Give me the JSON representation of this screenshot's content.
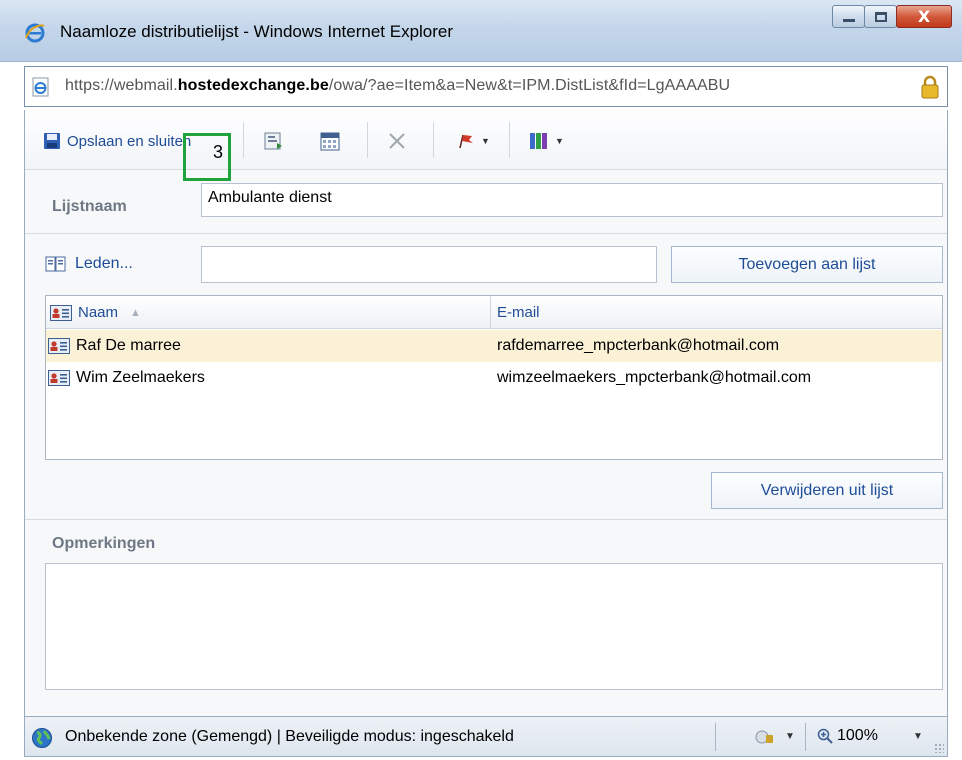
{
  "window": {
    "title": "Naamloze distributielijst - Windows Internet Explorer",
    "close_label": "X"
  },
  "address": {
    "prefix": "https://webmail.",
    "host": "hostedexchange.be",
    "path": "/owa/?ae=Item&a=New&t=IPM.DistList&fId=LgAAAABU"
  },
  "toolbar": {
    "save_label": "Opslaan en sluiten",
    "icons": [
      "save-icon",
      "address-card-icon",
      "calendar-icon",
      "delete-icon",
      "flag-icon",
      "categories-icon"
    ]
  },
  "overlay": {
    "marker": "3",
    "color": "#1fa33a"
  },
  "form": {
    "list_name_label": "Lijstnaam",
    "list_name_value": "Ambulante dienst",
    "members_label": "Leden...",
    "members_value": "",
    "add_button": "Toevoegen aan lijst",
    "remove_button": "Verwijderen uit lijst",
    "notes_label": "Opmerkingen",
    "notes_value": ""
  },
  "members_table": {
    "columns": [
      "Naam",
      "E-mail"
    ],
    "rows": [
      {
        "name": "Raf De marree",
        "email": "rafdemarree_mpcterbank@hotmail.com",
        "selected": true
      },
      {
        "name": "Wim Zeelmaekers",
        "email": "wimzeelmaekers_mpcterbank@hotmail.com",
        "selected": false
      }
    ]
  },
  "statusbar": {
    "zone_text": "Onbekende zone (Gemengd) | Beveiligde modus: ingeschakeld",
    "zoom": "100%"
  },
  "colors": {
    "accent_link": "#1e4c96",
    "selected_row": "#faf1d7",
    "focus_marker": "#1fa33a"
  }
}
